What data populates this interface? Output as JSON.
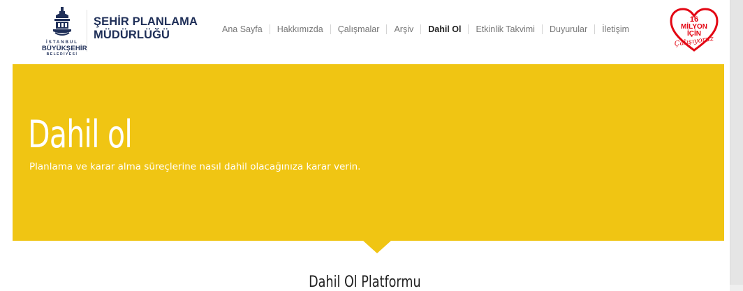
{
  "header": {
    "logo": {
      "icon": "ibb-crest-icon",
      "line1": "İSTANBUL",
      "line2": "BÜYÜKŞEHİR",
      "line3": "BELEDİYESİ"
    },
    "site_title_line1": "ŞEHİR PLANLAMA",
    "site_title_line2": "MÜDÜRLÜĞÜ",
    "nav": [
      {
        "label": "Ana Sayfa",
        "active": false
      },
      {
        "label": "Hakkımızda",
        "active": false
      },
      {
        "label": "Çalışmalar",
        "active": false
      },
      {
        "label": "Arşiv",
        "active": false
      },
      {
        "label": "Dahil Ol",
        "active": true
      },
      {
        "label": "Etkinlik Takvimi",
        "active": false
      },
      {
        "label": "Duyurular",
        "active": false
      },
      {
        "label": "İletişim",
        "active": false
      }
    ],
    "badge": {
      "icon": "heart-icon",
      "line1": "16",
      "line2": "MİLYON",
      "line3": "İÇİN",
      "line4": "Çalışıyoruz"
    }
  },
  "hero": {
    "title": "Dahil ol",
    "subtitle": "Planlama ve karar alma süreçlerine nasıl dahil olacağınıza karar verin."
  },
  "section": {
    "title": "Dahil Ol Platformu"
  },
  "colors": {
    "brand_navy": "#1f2f58",
    "hero_yellow": "#f0c513",
    "badge_red": "#e30613"
  }
}
